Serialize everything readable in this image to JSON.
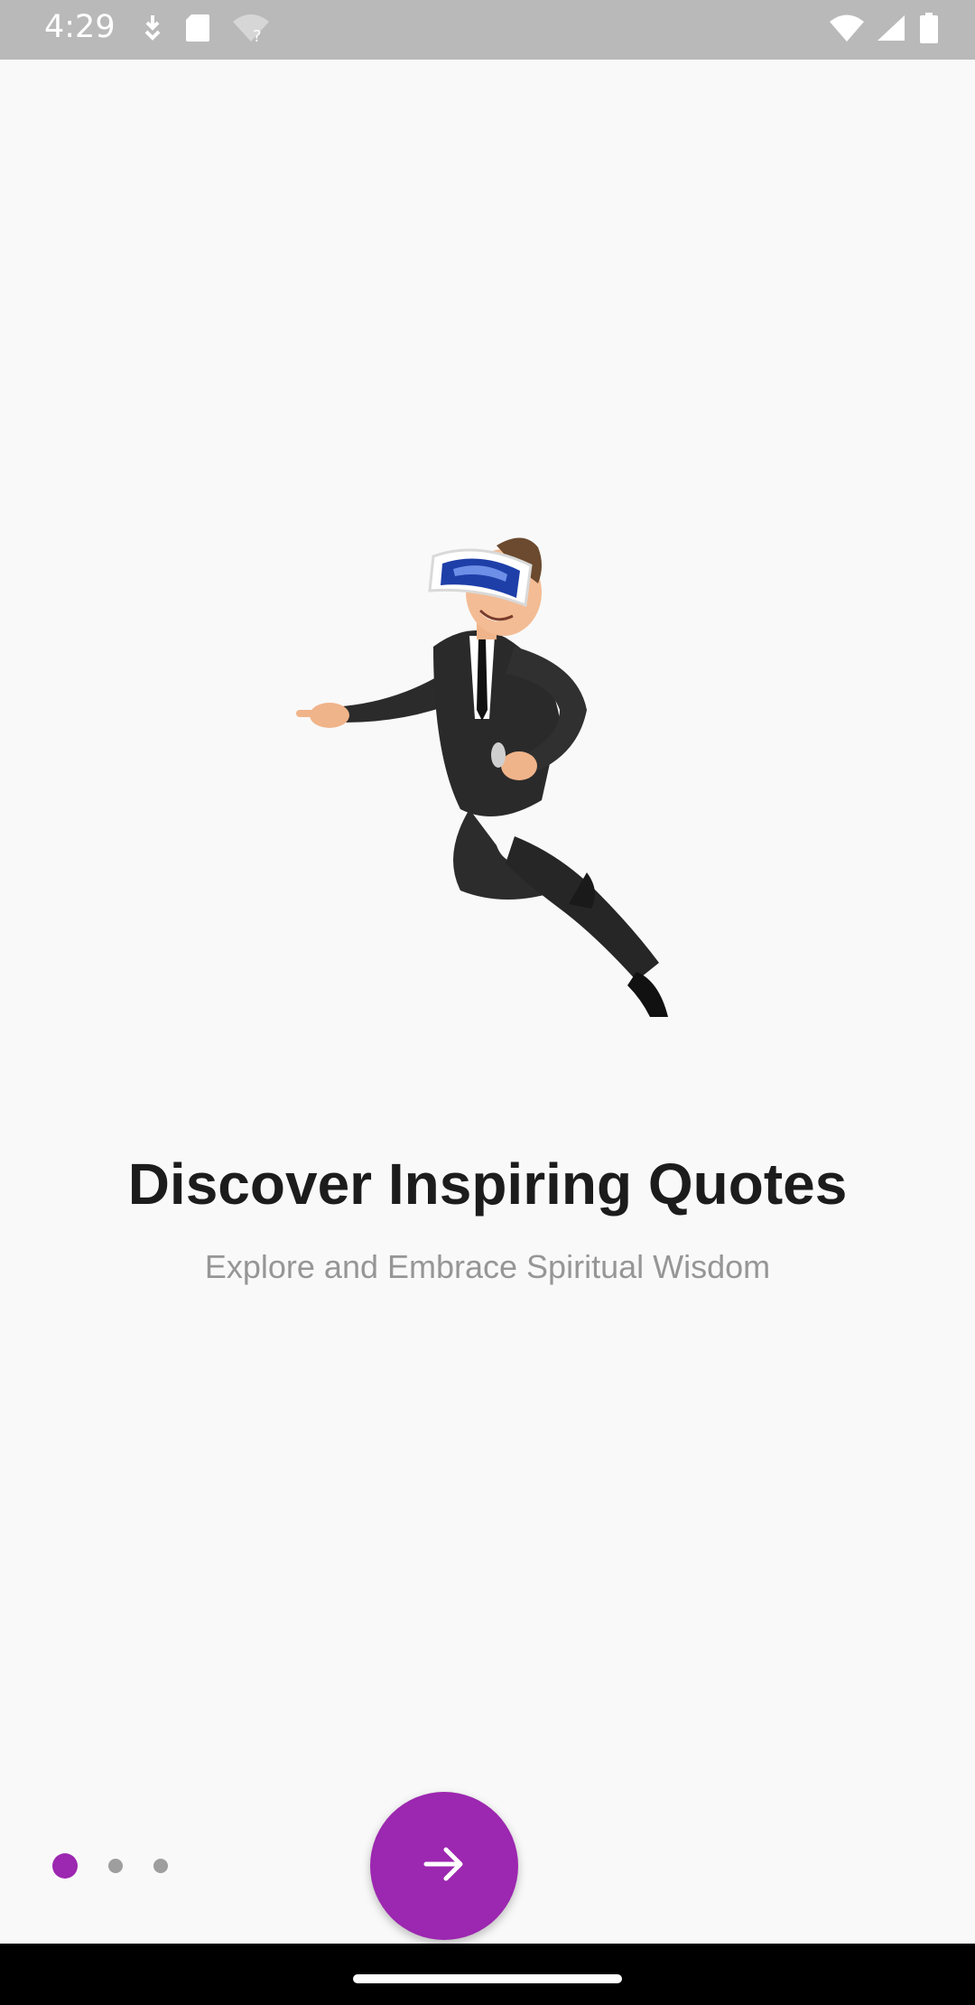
{
  "status_bar": {
    "time": "4:29",
    "icons_left": [
      "download-icon",
      "sd-card-icon",
      "wifi-unknown-icon"
    ],
    "icons_right": [
      "wifi-icon",
      "signal-icon",
      "battery-icon"
    ]
  },
  "onboarding": {
    "illustration": "businessman-vr-headset-illustration",
    "title": "Discover Inspiring Quotes",
    "subtitle": "Explore and Embrace Spiritual Wisdom",
    "page_indicator": {
      "total": 3,
      "current": 1
    },
    "next_button_icon": "arrow-right-icon"
  },
  "colors": {
    "accent": "#9c27b0",
    "inactive_dot": "#9e9e9e",
    "title_text": "#1c1c1c",
    "subtitle_text": "#969696",
    "background": "#f9f9f9",
    "status_bar": "#b9b9b9"
  }
}
